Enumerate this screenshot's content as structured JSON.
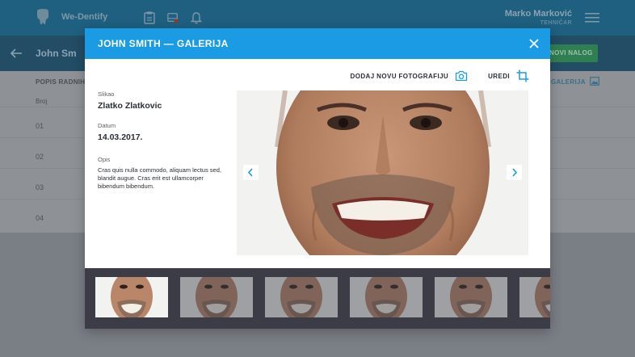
{
  "app": {
    "name": "We-Dentify"
  },
  "user": {
    "name": "Marko Marković",
    "role": "TEHNIČAR"
  },
  "subheader": {
    "title": "John Sm",
    "new_button": "NOVI NALOG"
  },
  "background_list": {
    "label": "POPIS RADNIH",
    "column": "Broj",
    "gallery_link": "GALERIJA",
    "rows": [
      "01",
      "02",
      "03",
      "04"
    ]
  },
  "modal": {
    "title": "JOHN SMITH — GALERIJA",
    "actions": {
      "add_photo": "DODAJ NOVU FOTOGRAFIJU",
      "edit": "UREDI"
    },
    "photographer_label": "Slikao",
    "photographer": "Zlatko Zlatkovic",
    "date_label": "Datum",
    "date": "14.03.2017.",
    "description_label": "Opis",
    "description": "Cras quis nulla commodo, aliquam lectus sed, blandit augue. Cras erit est ullamcorper bibendum bibendum.",
    "thumbnails": [
      {
        "selected": true
      },
      {
        "selected": false
      },
      {
        "selected": false
      },
      {
        "selected": false
      },
      {
        "selected": false
      },
      {
        "selected": false
      }
    ]
  },
  "colors": {
    "accent": "#1a9be3",
    "thumb_strip": "#3b3c45",
    "button_green": "#2f7f52"
  },
  "icons": [
    "logo-icon",
    "clipboard-icon",
    "inbox-icon",
    "bell-icon",
    "menu-icon",
    "back-arrow-icon",
    "gallery-icon",
    "close-icon",
    "camera-icon",
    "crop-icon",
    "chevron-left-icon",
    "chevron-right-icon"
  ]
}
